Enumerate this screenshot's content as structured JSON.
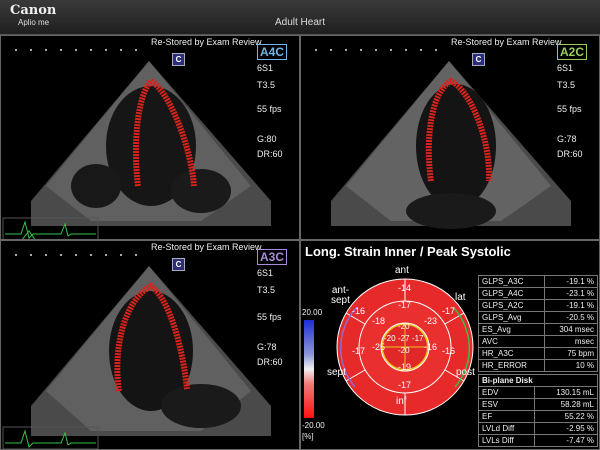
{
  "header": {
    "brand": "Canon",
    "brand_sub": "Aplio me",
    "title": "Adult Heart"
  },
  "panes": [
    {
      "id": "a4c",
      "status": "Re-Stored by Exam Review",
      "view": "A4C",
      "view_color": "#6fb6ea",
      "probe": "6S1",
      "thermal": "T3.5",
      "fps": "55 fps",
      "gain": "G:80",
      "dr": "DR:60"
    },
    {
      "id": "a2c",
      "status": "Re-Stored by Exam Review",
      "view": "A2C",
      "view_color": "#9acd5a",
      "probe": "6S1",
      "thermal": "T3.5",
      "fps": "55 fps",
      "gain": "G:78",
      "dr": "DR:60"
    },
    {
      "id": "a3c",
      "status": "Re-Stored by Exam Review",
      "view": "A3C",
      "view_color": "#a98bd8",
      "probe": "6S1",
      "thermal": "T3.5",
      "fps": "55 fps",
      "gain": "G:78",
      "dr": "DR:60"
    }
  ],
  "c_badge": "C",
  "strain": {
    "title": "Long. Strain Inner / Peak Systolic",
    "scale_max": "20.00",
    "scale_min": "-20.00",
    "scale_unit": "[%]",
    "wall_labels": {
      "ant": "ant",
      "ant_sept": "ant-\nsept",
      "lat": "lat",
      "sept": "sept",
      "post": "post",
      "inf": "inf"
    },
    "outer_ring": [
      "-14",
      "-17",
      "-16",
      "-17",
      "-17",
      "-16"
    ],
    "mid_ring": [
      "-17",
      "-23",
      "-16",
      "-19",
      "-25",
      "-18"
    ],
    "apex_ring": [
      "-20",
      "-17",
      "-20",
      "-20"
    ],
    "center": "-27"
  },
  "results": [
    {
      "label": "GLPS_A3C",
      "value": "-19.1 %"
    },
    {
      "label": "GLPS_A4C",
      "value": "-23.1 %"
    },
    {
      "label": "GLPS_A2C",
      "value": "-19.1 %"
    },
    {
      "label": "GLPS_Avg",
      "value": "-20.5 %"
    },
    {
      "label": "ES_Avg",
      "value": "304 msec"
    },
    {
      "label": "AVC",
      "value": "msec"
    },
    {
      "label": "HR_A3C",
      "value": "75 bpm"
    },
    {
      "label": "HR_ERROR",
      "value": "10 %"
    }
  ],
  "biplane": {
    "header": "Bi-plane Disk",
    "rows": [
      {
        "label": "EDV",
        "value": "130.15 mL"
      },
      {
        "label": "ESV",
        "value": "58.28 mL"
      },
      {
        "label": "EF",
        "value": "55.22 %"
      },
      {
        "label": "LVLd Diff",
        "value": "-2.95 %"
      },
      {
        "label": "LVLs Diff",
        "value": "-7.47 %"
      }
    ]
  },
  "colors": {
    "trace": "#d8241c",
    "ecg": "#35c24a",
    "accent_a4c": "#6fb6ea",
    "accent_a2c": "#9acd5a",
    "accent_a3c": "#a98bd8"
  }
}
